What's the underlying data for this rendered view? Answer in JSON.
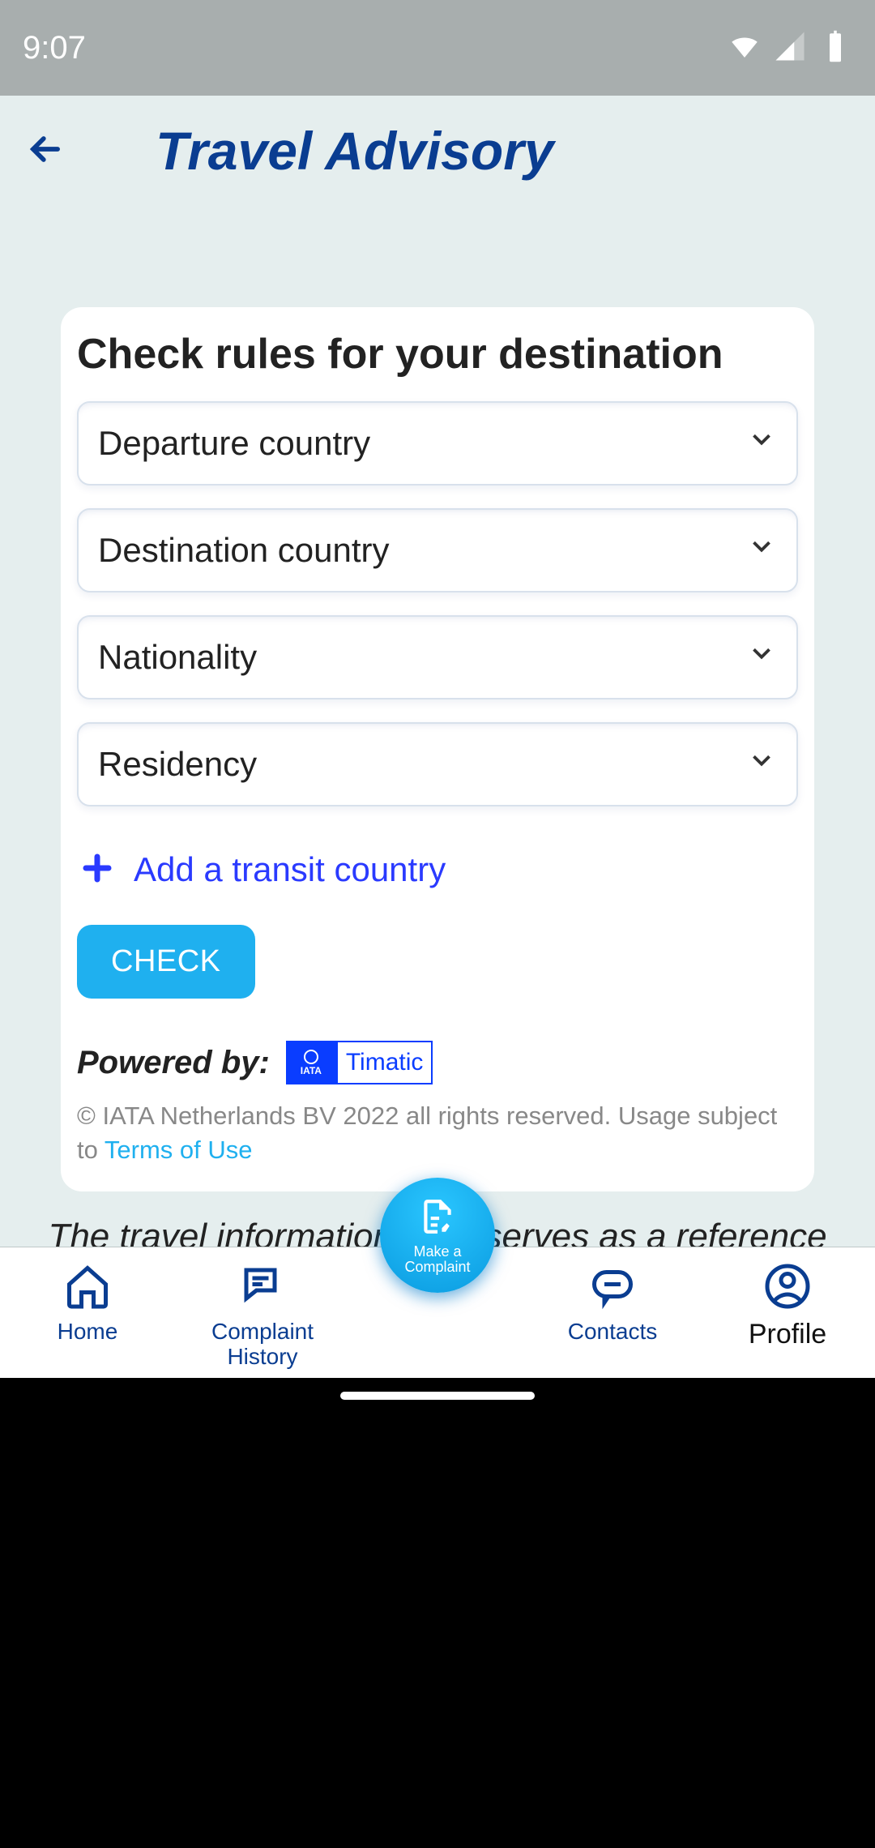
{
  "statusbar": {
    "time": "9:07"
  },
  "header": {
    "title": "Travel Advisory"
  },
  "card": {
    "title": "Check rules for your destination",
    "fields": {
      "departure": "Departure country",
      "destination": "Destination country",
      "nationality": "Nationality",
      "residency": "Residency"
    },
    "add_transit_label": "Add a transit country",
    "check_label": "CHECK",
    "powered_by": "Powered by:",
    "timatic_brand": "Timatic",
    "iata_label": "IATA",
    "copyright": "© IATA Netherlands BV 2022 all rights reserved. Usage subject to ",
    "terms_label": "Terms of Use"
  },
  "disclaimer": "The travel information here serves as a reference guide for travellers prior to their travel.",
  "fab": {
    "label": "Make a Complaint"
  },
  "tabs": {
    "home": "Home",
    "history": "Complaint History",
    "contacts": "Contacts",
    "profile": "Profile"
  }
}
